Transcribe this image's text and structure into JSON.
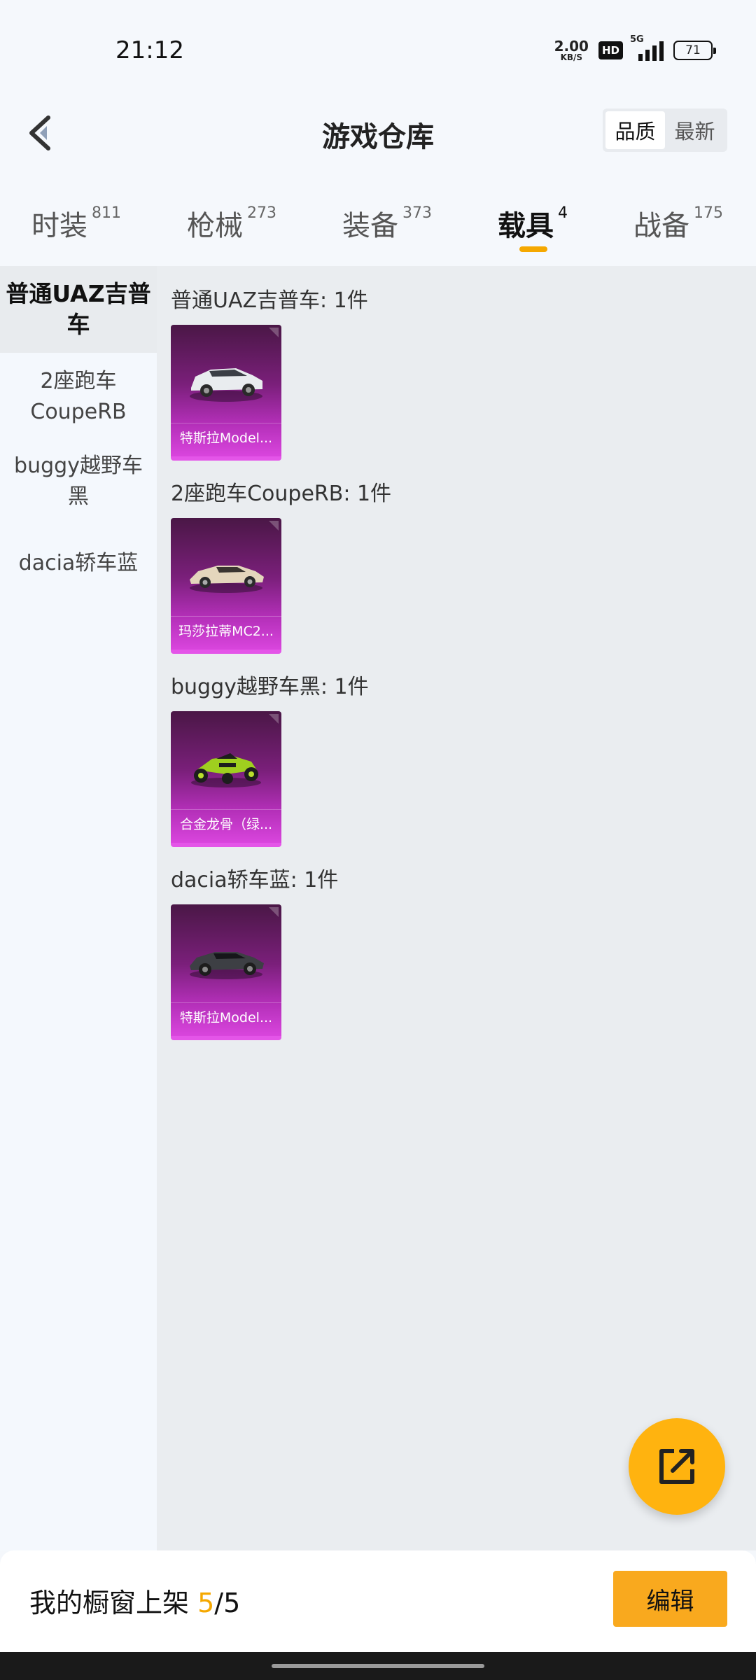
{
  "status": {
    "time": "21:12",
    "net_speed_value": "2.00",
    "net_speed_unit": "KB/S",
    "hd": "HD",
    "signal_tag": "5G",
    "battery": "71"
  },
  "header": {
    "title": "游戏仓库",
    "sort_options": [
      "品质",
      "最新"
    ],
    "sort_selected": "品质"
  },
  "tabs": [
    {
      "label": "时装",
      "count": "811"
    },
    {
      "label": "枪械",
      "count": "273"
    },
    {
      "label": "装备",
      "count": "373"
    },
    {
      "label": "载具",
      "count": "4"
    },
    {
      "label": "战备",
      "count": "175"
    }
  ],
  "active_tab": "载具",
  "sidebar": {
    "items": [
      {
        "label": "普通UAZ吉普车"
      },
      {
        "label": "2座跑车CoupeRB"
      },
      {
        "label": "buggy越野车黑"
      },
      {
        "label": "dacia轿车蓝"
      }
    ],
    "active_index": 0
  },
  "groups": [
    {
      "title": "普通UAZ吉普车: 1件",
      "items": [
        {
          "label": "特斯拉Model...",
          "icon": "white-suv-car"
        }
      ]
    },
    {
      "title": "2座跑车CoupeRB: 1件",
      "items": [
        {
          "label": "玛莎拉蒂MC2...",
          "icon": "cream-sports-car"
        }
      ]
    },
    {
      "title": "buggy越野车黑: 1件",
      "items": [
        {
          "label": "合金龙骨（绿...",
          "icon": "green-buggy"
        }
      ]
    },
    {
      "title": "dacia轿车蓝: 1件",
      "items": [
        {
          "label": "特斯拉Model...",
          "icon": "dark-sedan-car"
        }
      ]
    }
  ],
  "bottom": {
    "showcase_prefix": "我的橱窗上架 ",
    "showcase_current": "5",
    "showcase_total": "/5",
    "edit_label": "编辑"
  },
  "colors": {
    "accent": "#f5a800",
    "card_purple": "#b32fb8",
    "fab": "#ffb30f"
  }
}
